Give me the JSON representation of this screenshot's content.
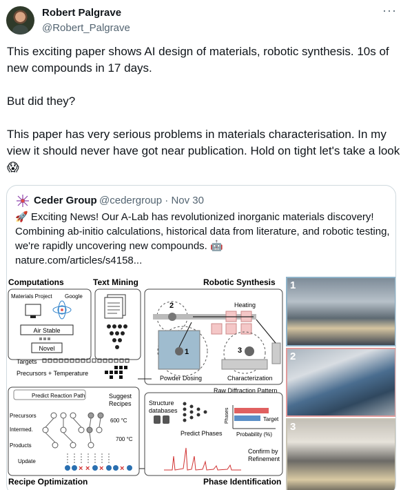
{
  "author": {
    "name": "Robert Palgrave",
    "handle": "@Robert_Palgrave",
    "more_icon": "ellipsis-icon"
  },
  "tweet": {
    "text": "This exciting paper shows AI design of materials, robotic synthesis. 10s of new compounds in 17 days.\n\nBut did they?\n\nThis paper has very serious problems in materials characterisation. In my view it should never have got near publication. Hold on tight let's take a look 😱"
  },
  "quote": {
    "name": "Ceder Group",
    "meta": "@cedergroup · Nov 30",
    "text": "🚀 Exciting News! Our A-Lab has revolutionized inorganic materials discovery! Combining ab-initio calculations, historical data from literature, and robotic testing, we're rapidly uncovering new compounds. 🤖",
    "link": "nature.com/articles/s4158..."
  },
  "figure": {
    "computations": "Computations",
    "text_mining": "Text Mining",
    "robotic_synthesis": "Robotic Synthesis",
    "materials_project": "Materials Project",
    "google": "Google",
    "air_stable": "Air Stable",
    "novel": "Novel",
    "targets": "Targets",
    "precursors_temperature": "Precursors + Temperature",
    "heating": "Heating",
    "powder_dosing": "Powder Dosing",
    "characterization": "Characterization",
    "raw_diffraction": "Raw Diffraction Pattern",
    "predict_reaction_path": "Predict Reaction Path",
    "suggest_recipes": "Suggest\nRecipes",
    "precursors": "Precursors",
    "intermed": "Intermed.",
    "products": "Products",
    "update": "Update",
    "t600": "600 °C",
    "t700": "700 °C",
    "structure_databases": "Structure\ndatabases",
    "predict_phases": "Predict Phases",
    "phases": "Phases",
    "target": "Target",
    "probability": "Probability (%)",
    "confirm_refinement": "Confirm by\nRefinement",
    "recipe_optimization": "Recipe Optimization",
    "phase_identification": "Phase Identification",
    "step1": "1",
    "step2": "2",
    "step3": "3",
    "photo1": "1",
    "photo2": "2",
    "photo3": "3"
  },
  "colors": {
    "photo1_border": "#8fb3c9",
    "photo2_border": "#e19a9a",
    "photo3_border": "#c9c4b4",
    "pink": "#f4c7c7",
    "blue": "#9fbccf",
    "red_bar": "#e06060",
    "blue_bar": "#5b8fc7"
  }
}
